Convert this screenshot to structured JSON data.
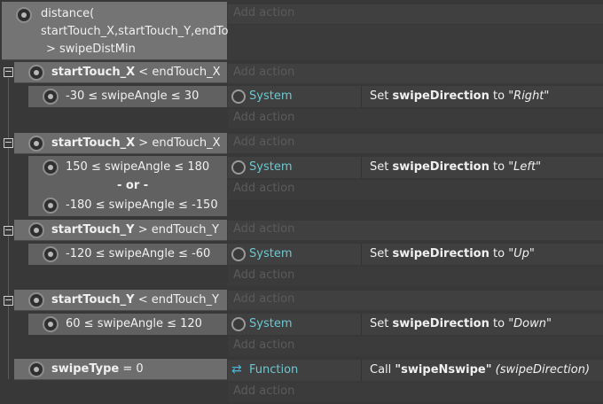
{
  "add_action_label": "Add action",
  "top_event": {
    "lines": [
      "distance(",
      "startTouch_X,startTouch_Y,endTouch_X,endTouch_Y)",
      "> swipeDistMin"
    ]
  },
  "groups": [
    {
      "cond_bold": "startTouch_X",
      "cond_rest": " < endTouch_X",
      "subs": [
        {
          "condition": "-30 ≤ swipeAngle ≤ 30",
          "object": "System",
          "action_prefix": "Set ",
          "action_bold": "swipeDirection",
          "action_mid": " to ",
          "action_italic": "\"Right\""
        }
      ]
    },
    {
      "cond_bold": "startTouch_X",
      "cond_rest": " > endTouch_X",
      "subs": [
        {
          "condition": "150 ≤ swipeAngle ≤ 180",
          "or_label": "- or -",
          "condition2": "-180 ≤ swipeAngle ≤ -150",
          "object": "System",
          "action_prefix": "Set ",
          "action_bold": "swipeDirection",
          "action_mid": " to ",
          "action_italic": "\"Left\""
        }
      ]
    },
    {
      "cond_bold": "startTouch_Y",
      "cond_rest": " > endTouch_Y",
      "subs": [
        {
          "condition": "-120 ≤ swipeAngle ≤ -60",
          "object": "System",
          "action_prefix": "Set ",
          "action_bold": "swipeDirection",
          "action_mid": " to ",
          "action_italic": "\"Up\""
        }
      ]
    },
    {
      "cond_bold": "startTouch_Y",
      "cond_rest": " < endTouch_Y",
      "subs": [
        {
          "condition": "60 ≤ swipeAngle ≤ 120",
          "object": "System",
          "action_prefix": "Set ",
          "action_bold": "swipeDirection",
          "action_mid": " to ",
          "action_italic": "\"Down\""
        }
      ]
    }
  ],
  "final_event": {
    "cond_bold": "swipeType",
    "cond_rest": " = 0",
    "object": "Function",
    "action_prefix": "Call ",
    "action_bold": "\"swipeNswipe\"",
    "action_italic": " (swipeDirection)"
  },
  "icons": {
    "condition": "gear-icon",
    "system": "gear-icon",
    "function": "function-icon",
    "toggle": "collapse-icon"
  },
  "colors": {
    "object_text": "#6ec6cf",
    "condition_bg": "#6d6d6d",
    "action_bg": "#404040"
  }
}
